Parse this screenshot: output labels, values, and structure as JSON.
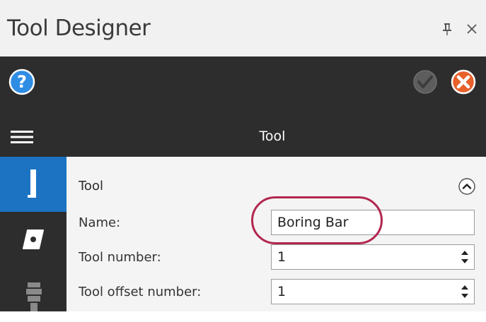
{
  "window": {
    "title": "Tool Designer"
  },
  "toolbar": {
    "help_icon": "help-icon",
    "ok_icon": "check-icon",
    "cancel_icon": "close-icon"
  },
  "navbar": {
    "title": "Tool"
  },
  "sidebar": {
    "tabs": [
      {
        "icon": "tool-holder-icon",
        "active": true
      },
      {
        "icon": "insert-icon",
        "active": false
      },
      {
        "icon": "tool-stack-icon",
        "active": false
      }
    ]
  },
  "section": {
    "title": "Tool"
  },
  "fields": {
    "name": {
      "label": "Name:",
      "value": "Boring Bar"
    },
    "tool_number": {
      "label": "Tool number:",
      "value": "1"
    },
    "tool_offset_number": {
      "label": "Tool offset number:",
      "value": "1"
    }
  },
  "colors": {
    "accent": "#1b73c2",
    "dark": "#2d2d2d",
    "highlight": "#b2274f",
    "cancel": "#e8602a"
  }
}
